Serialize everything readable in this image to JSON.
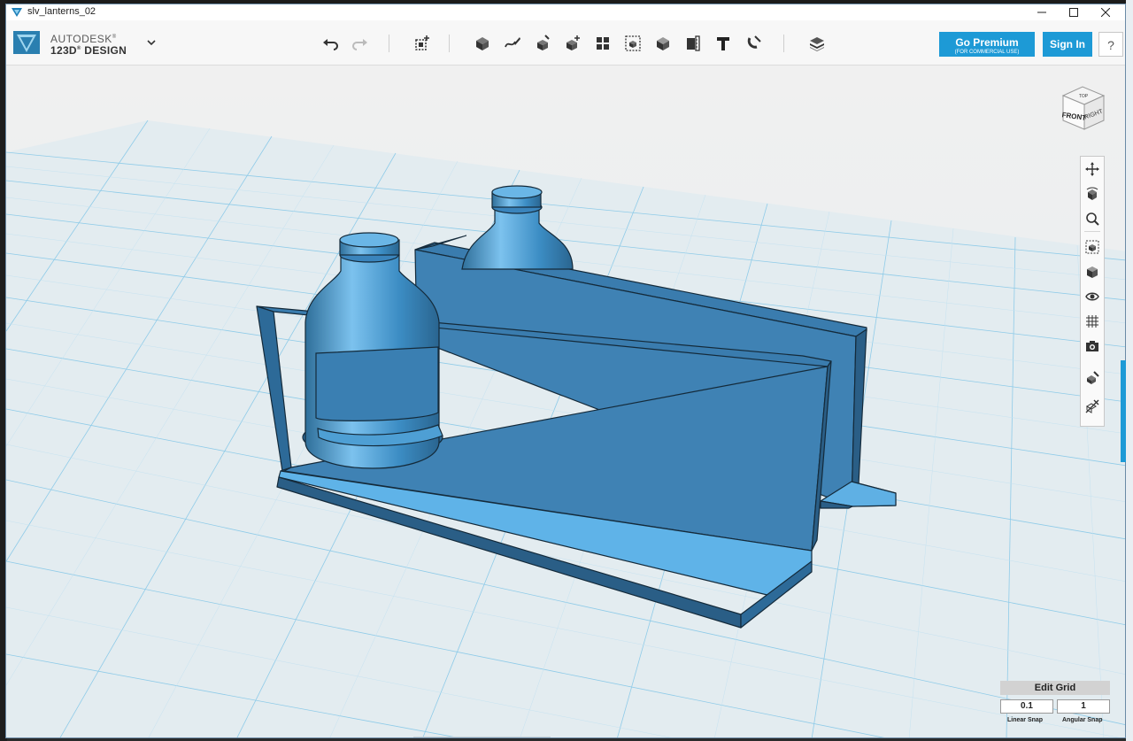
{
  "window": {
    "title": "slv_lanterns_02"
  },
  "brand": {
    "line1": "AUTODESK",
    "line1_reg": "®",
    "line2": "123D",
    "line2_reg": "®",
    "line2_rest": " DESIGN"
  },
  "toolbar_icons": [
    "undo-icon",
    "redo-icon",
    "transform-icon",
    "primitives-icon",
    "sketch-icon",
    "construct-icon",
    "modify-icon",
    "pattern-icon",
    "grouping-icon",
    "combine-icon",
    "measure-icon",
    "text-icon",
    "snap-icon",
    "material-icon"
  ],
  "buttons": {
    "premium_line1": "Go Premium",
    "premium_line2": "(FOR COMMERCIAL USE)",
    "signin": "Sign In",
    "help": "?"
  },
  "viewcube": {
    "front": "FRONT",
    "right": "RIGHT",
    "top": "TOP"
  },
  "navbar_icons": [
    "pan-icon",
    "orbit-icon",
    "zoom-icon",
    "fit-icon",
    "view-icon",
    "visibility-icon",
    "grid-toggle-icon",
    "camera-icon",
    "material-toggle-icon",
    "outline-icon"
  ],
  "grid": {
    "edit_label": "Edit Grid",
    "linear_value": "0.1",
    "angular_value": "1",
    "linear_label": "Linear Snap",
    "angular_label": "Angular Snap"
  },
  "colors": {
    "accent": "#1d9ad6",
    "model": "#4a9fd8",
    "grid_bg": "#e6eef2"
  }
}
